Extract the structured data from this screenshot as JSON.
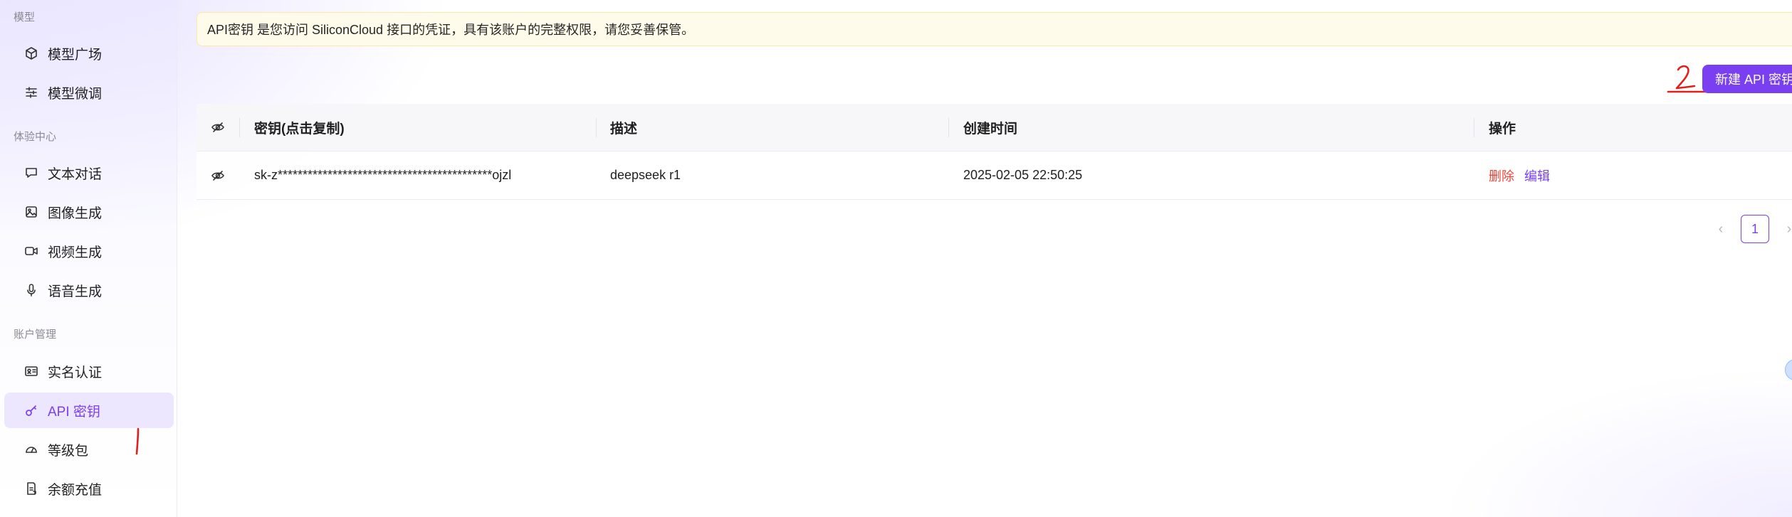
{
  "sidebar": {
    "groups": [
      {
        "title": "模型"
      },
      {
        "title": "体验中心"
      },
      {
        "title": "账户管理"
      }
    ],
    "items": [
      {
        "label": "模型广场",
        "icon": "cube-icon"
      },
      {
        "label": "模型微调",
        "icon": "sliders-icon"
      },
      {
        "label": "文本对话",
        "icon": "chat-icon"
      },
      {
        "label": "图像生成",
        "icon": "image-icon"
      },
      {
        "label": "视频生成",
        "icon": "video-icon"
      },
      {
        "label": "语音生成",
        "icon": "microphone-icon"
      },
      {
        "label": "实名认证",
        "icon": "id-card-icon"
      },
      {
        "label": "API 密钥",
        "icon": "key-icon",
        "active": true
      },
      {
        "label": "等级包",
        "icon": "gauge-icon"
      },
      {
        "label": "余额充值",
        "icon": "wallet-icon"
      }
    ]
  },
  "notice": {
    "text": "API密钥 是您访问 SiliconCloud 接口的凭证，具有该账户的完整权限，请您妥善保管。"
  },
  "toolbar": {
    "new_key_label": "新建 API 密钥"
  },
  "table": {
    "headers": {
      "key": "密钥(点击复制)",
      "description": "描述",
      "created": "创建时间",
      "actions": "操作"
    },
    "rows": [
      {
        "key": "sk-z*******************************************ojzl",
        "description": "deepseek r1",
        "created": "2025-02-05 22:50:25",
        "delete_label": "删除",
        "edit_label": "编辑"
      }
    ]
  },
  "pagination": {
    "current_page": "1",
    "prev": "‹",
    "next": "›"
  },
  "annotations": {
    "mark_1": "1",
    "mark_2": "2"
  },
  "colors": {
    "accent": "#7b3ff2",
    "danger": "#f04438",
    "notice_bg": "#fffbea",
    "annotation": "#e0201e"
  }
}
